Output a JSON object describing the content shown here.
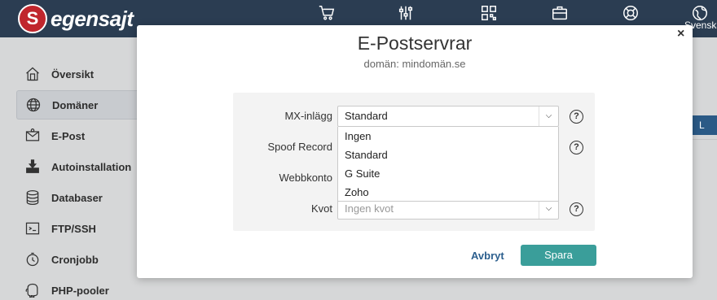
{
  "header": {
    "logo_mark": "S",
    "logo_text": "egensajt",
    "lang_label": "Svenska",
    "icons": [
      "cart-icon",
      "sliders-icon",
      "qr-icon",
      "briefcase-icon",
      "lifebuoy-icon",
      "globe-icon"
    ]
  },
  "sidebar": {
    "items": [
      {
        "label": "Översikt",
        "icon": "home-icon"
      },
      {
        "label": "Domäner",
        "icon": "globe-icon",
        "active": true
      },
      {
        "label": "E-Post",
        "icon": "mail-icon"
      },
      {
        "label": "Autoinstallation",
        "icon": "download-icon"
      },
      {
        "label": "Databaser",
        "icon": "database-icon"
      },
      {
        "label": "FTP/SSH",
        "icon": "terminal-icon"
      },
      {
        "label": "Cronjobb",
        "icon": "clock-icon"
      },
      {
        "label": "PHP-pooler",
        "icon": "php-icon"
      }
    ]
  },
  "background": {
    "right_tab_label": "L"
  },
  "modal": {
    "title": "E-Postservrar",
    "subtitle": "domän: mindomän.se",
    "close_label": "×",
    "fields": {
      "mx": {
        "label": "MX-inlägg",
        "value": "Standard"
      },
      "spoof": {
        "label": "Spoof Record"
      },
      "webmail": {
        "label": "Webbkonto"
      },
      "quota": {
        "label": "Kvot",
        "placeholder": "Ingen kvot"
      }
    },
    "dropdown_options": [
      "Ingen",
      "Standard",
      "G Suite",
      "Zoho"
    ],
    "help_label": "?",
    "cancel_label": "Avbryt",
    "save_label": "Spara"
  },
  "colors": {
    "topbar": "#2b3d52",
    "save_button": "#3a9e9a",
    "cancel_link": "#2c5f8e",
    "logo_red": "#c0262d"
  }
}
